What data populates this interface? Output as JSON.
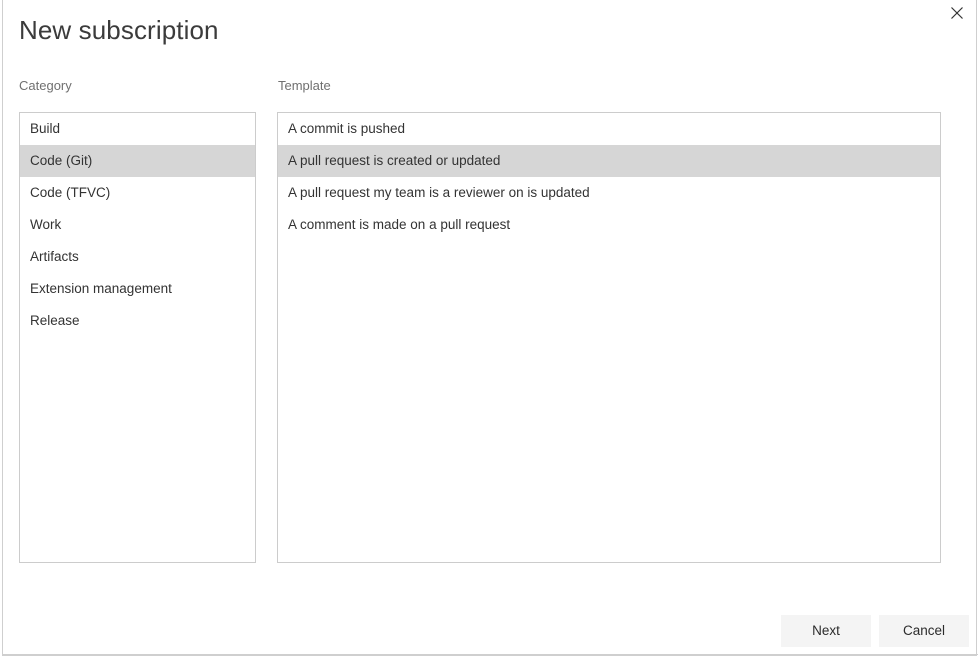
{
  "dialog": {
    "title": "New subscription",
    "close_icon": "close-icon"
  },
  "columns": {
    "category_label": "Category",
    "template_label": "Template"
  },
  "category": {
    "selected_index": 1,
    "items": [
      {
        "label": "Build"
      },
      {
        "label": "Code (Git)"
      },
      {
        "label": "Code (TFVC)"
      },
      {
        "label": "Work"
      },
      {
        "label": "Artifacts"
      },
      {
        "label": "Extension management"
      },
      {
        "label": "Release"
      }
    ]
  },
  "template": {
    "selected_index": 1,
    "items": [
      {
        "label": "A commit is pushed"
      },
      {
        "label": "A pull request is created or updated"
      },
      {
        "label": "A pull request my team is a reviewer on is updated"
      },
      {
        "label": "A comment is made on a pull request"
      }
    ]
  },
  "footer": {
    "next_label": "Next",
    "cancel_label": "Cancel"
  },
  "colors": {
    "selection": "#d6d6d6",
    "border": "#cccccc",
    "dialog_border": "#cfcfcf",
    "button_bg": "#f4f4f4",
    "title_text": "#3b3b3b",
    "label_text": "#707070",
    "item_text": "#333333"
  }
}
